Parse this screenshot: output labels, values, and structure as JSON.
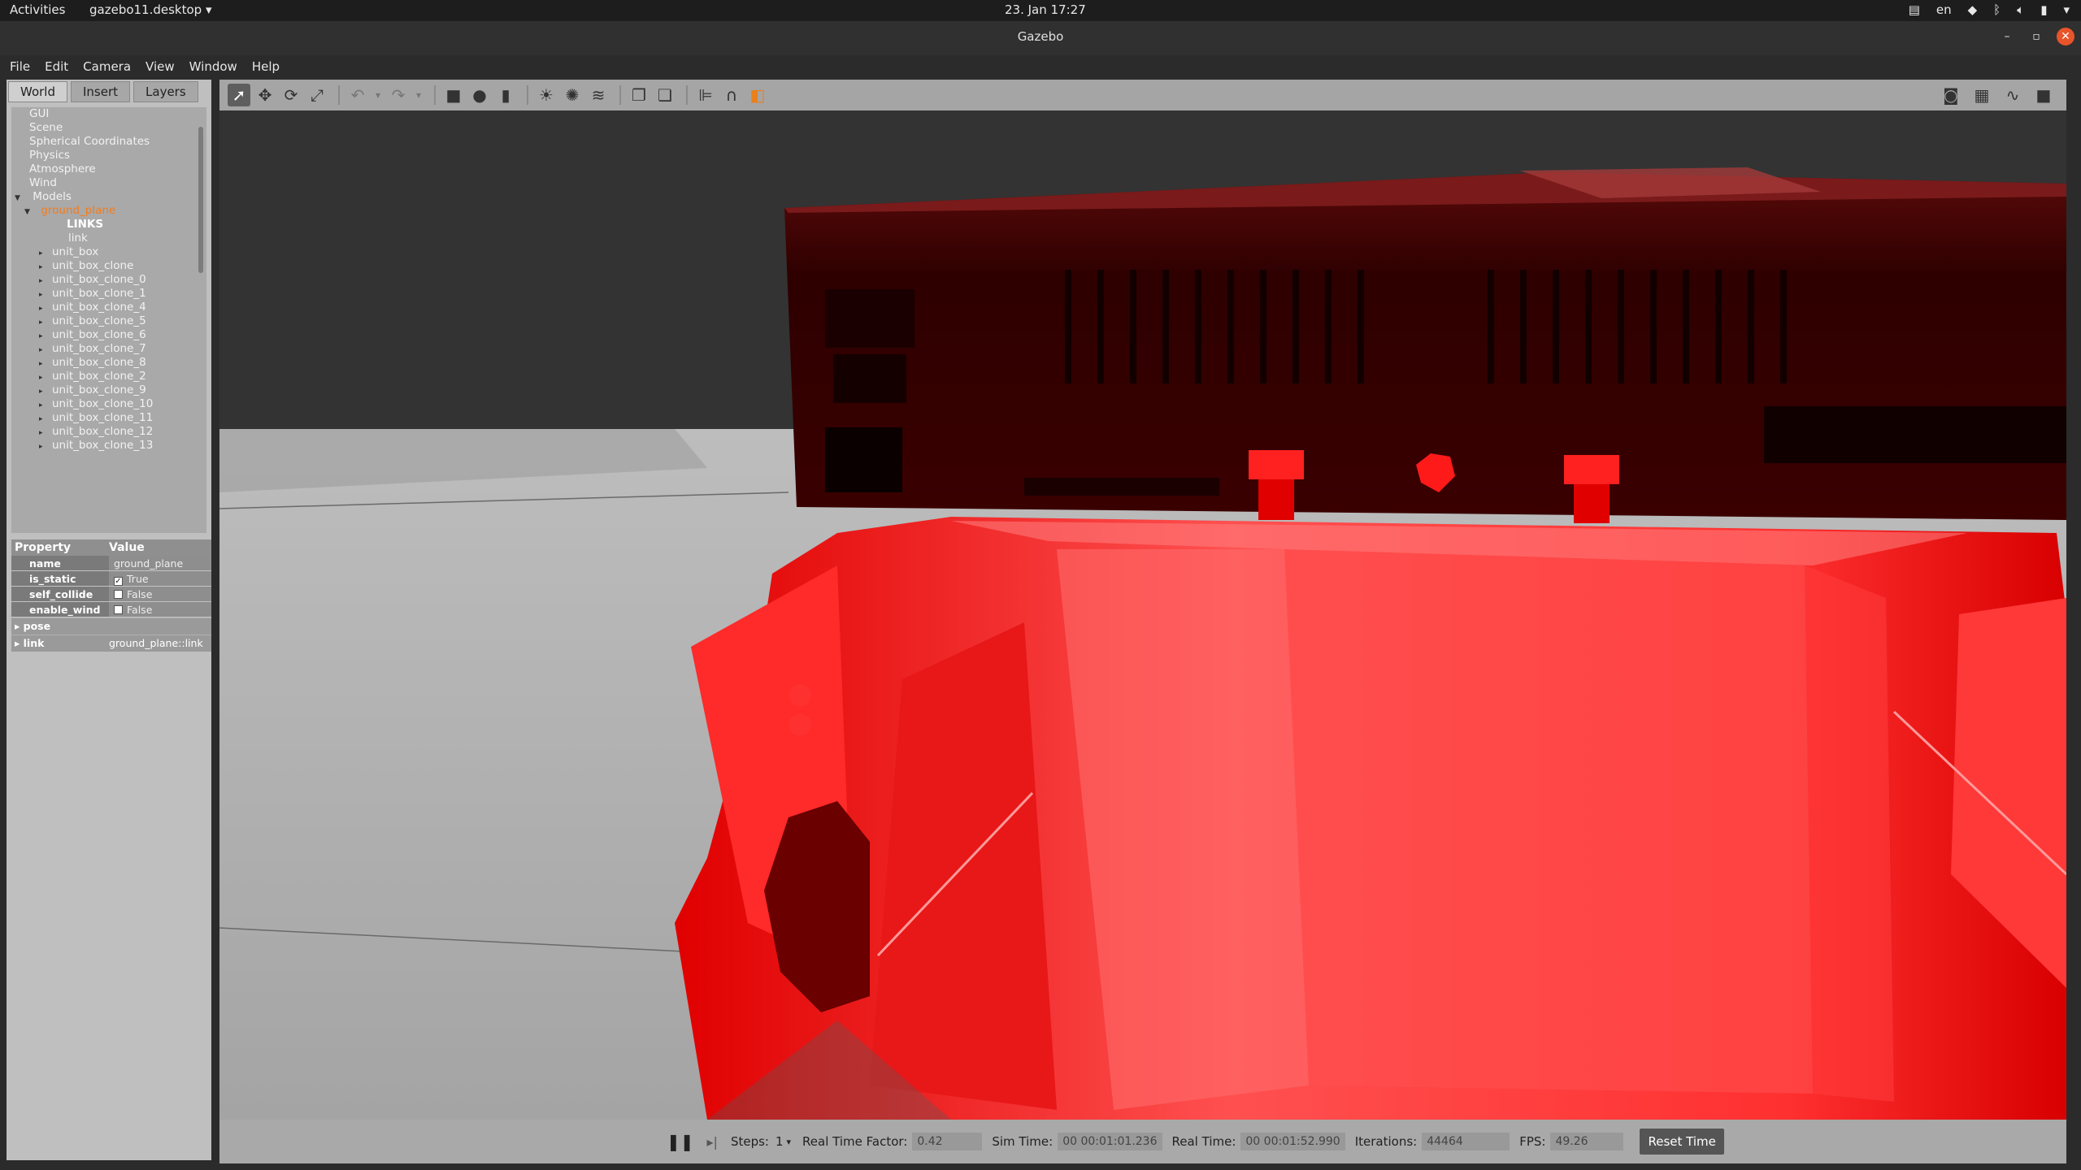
{
  "topbar": {
    "activities": "Activities",
    "app": "gazebo11.desktop",
    "clock": "23. Jan  17:27",
    "lang": "en"
  },
  "window": {
    "title": "Gazebo"
  },
  "menu": [
    "File",
    "Edit",
    "Camera",
    "View",
    "Window",
    "Help"
  ],
  "left_panel": {
    "tabs": [
      "World",
      "Insert",
      "Layers"
    ],
    "tree_top": [
      "GUI",
      "Scene",
      "Spherical Coordinates",
      "Physics",
      "Atmosphere",
      "Wind"
    ],
    "models_label": "Models",
    "selected_model": "ground_plane",
    "links_label": "LINKS",
    "link_label": "link",
    "models": [
      "unit_box",
      "unit_box_clone",
      "unit_box_clone_0",
      "unit_box_clone_1",
      "unit_box_clone_4",
      "unit_box_clone_5",
      "unit_box_clone_6",
      "unit_box_clone_7",
      "unit_box_clone_8",
      "unit_box_clone_2",
      "unit_box_clone_9",
      "unit_box_clone_10",
      "unit_box_clone_11",
      "unit_box_clone_12",
      "unit_box_clone_13"
    ],
    "props_header": [
      "Property",
      "Value"
    ],
    "props": [
      {
        "key": "name",
        "value": "ground_plane",
        "check": ""
      },
      {
        "key": "is_static",
        "value": "True",
        "check": "✓"
      },
      {
        "key": "self_collide",
        "value": "False",
        "check": " "
      },
      {
        "key": "enable_wind",
        "value": "False",
        "check": " "
      }
    ],
    "groups": [
      {
        "key": "pose",
        "value": ""
      },
      {
        "key": "link",
        "value": "ground_plane::link"
      }
    ]
  },
  "bottom": {
    "steps_label": "Steps:",
    "steps_value": "1",
    "rtf_label": "Real Time Factor:",
    "rtf_value": "0.42",
    "sim_label": "Sim Time:",
    "sim_value": "00 00:01:01.236",
    "real_label": "Real Time:",
    "real_value": "00 00:01:52.990",
    "iter_label": "Iterations:",
    "iter_value": "44464",
    "fps_label": "FPS:",
    "fps_value": "49.26",
    "reset_label": "Reset Time"
  },
  "colors": {
    "robot_red": "#ff2020",
    "selection_orange": "#f07d20"
  }
}
